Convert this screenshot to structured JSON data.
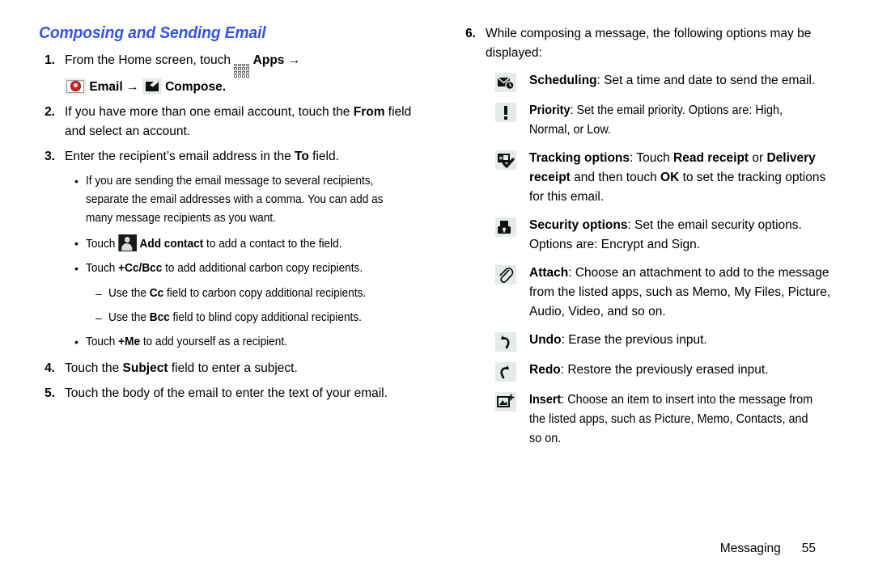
{
  "document": {
    "title_color": "#3355ee",
    "section_title": "Composing and Sending Email"
  },
  "left_column": {
    "steps": [
      {
        "number": "1.",
        "text_before_apps": "From the Home screen, touch ",
        "apps_label": "Apps",
        "arrow1": "→",
        "email_label": "Email",
        "arrow2": "→",
        "compose_label": "Compose",
        "period": "."
      },
      {
        "number": "2.",
        "line1": "If you have more than one email account, touch the ",
        "bold1": "From",
        "line2": " field and select an account."
      },
      {
        "number": "3.",
        "line1": "Enter the recipient’s email address in the ",
        "bold1": "To",
        "line2": " field."
      }
    ],
    "bullets": [
      {
        "marker": "•",
        "text": "If you are sending the email message to several recipients, separate the email addresses with a comma. You can add as many message recipients as you want."
      },
      {
        "marker": "•",
        "prefix": "Touch ",
        "icon": "add-contact-icon",
        "bold": "Add contact",
        "suffix": " to add a contact to the field."
      },
      {
        "marker": "•",
        "prefix": "Touch ",
        "bold": "+Cc/Bcc",
        "suffix": " to add additional carbon copy recipients."
      }
    ],
    "dashes": [
      {
        "marker": "–",
        "prefix": "Use the ",
        "bold": "Cc",
        "suffix": " field to carbon copy additional recipients."
      },
      {
        "marker": "–",
        "prefix": "Use the ",
        "bold": "Bcc",
        "suffix": " field to blind copy additional recipients."
      }
    ],
    "bullet_me": {
      "marker": "•",
      "prefix": "Touch ",
      "bold": "+Me",
      "suffix": " to add yourself as a recipient."
    },
    "steps_tail": [
      {
        "number": "4.",
        "line1": "Touch the ",
        "bold1": "Subject",
        "line2": " field to enter a subject."
      },
      {
        "number": "5.",
        "line1": "Touch the body of the email to enter the text of your email.",
        "bold1": "",
        "line2": ""
      }
    ]
  },
  "right_column": {
    "step6": {
      "number": "6.",
      "text": "While composing a message, the following options may be displayed:"
    },
    "options": [
      {
        "icon": "scheduling-icon",
        "bold": "Scheduling",
        "text": ": Set a time and date to send the email."
      },
      {
        "icon": "priority-icon",
        "bold": "Priority",
        "text": ": Set the email priority. Options are: High, Normal, or Low."
      },
      {
        "icon": "tracking-options-icon",
        "bold": "Tracking options",
        "text": ": Touch ",
        "bold2": "Read receipt",
        "text2": " or ",
        "bold3": "Delivery receipt",
        "text3": " and then touch ",
        "bold4": "OK",
        "text4": " to set the tracking options for this email."
      },
      {
        "icon": "security-options-icon",
        "bold": "Security options",
        "text": ": Set the email security options. Options are: Encrypt and Sign."
      },
      {
        "icon": "attach-icon",
        "bold": "Attach",
        "text": ": Choose an attachment to add to the message from the listed apps, such as Memo, My Files, Picture, Audio, Video, and so on."
      },
      {
        "icon": "undo-icon",
        "bold": "Undo",
        "text": ": Erase the previous input."
      },
      {
        "icon": "redo-icon",
        "bold": "Redo",
        "text": ": Restore the previously erased input."
      },
      {
        "icon": "insert-icon",
        "bold": "Insert",
        "text": ": Choose an item to insert into the message from the listed apps, such as Picture, Memo, Contacts, and so on."
      }
    ]
  },
  "footer": {
    "label": "Messaging",
    "page_number": "55"
  }
}
